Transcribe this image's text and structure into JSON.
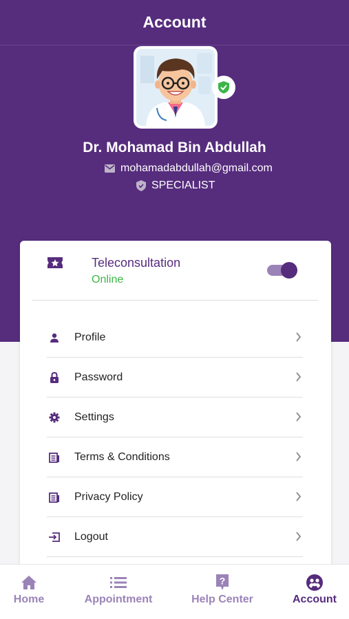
{
  "header": {
    "title": "Account"
  },
  "profile": {
    "name": "Dr. Mohamad Bin Abdullah",
    "email": "mohamadabdullah@gmail.com",
    "role": "SPECIALIST",
    "avatar_icon": "doctor-avatar",
    "verified_icon": "verified-shield-icon"
  },
  "teleconsultation": {
    "title": "Teleconsultation",
    "status": "Online",
    "toggle_on": true,
    "icon": "ticket-star-icon"
  },
  "menu": {
    "items": [
      {
        "label": "Profile",
        "icon": "person-icon"
      },
      {
        "label": "Password",
        "icon": "lock-icon"
      },
      {
        "label": "Settings",
        "icon": "gear-icon"
      },
      {
        "label": "Terms & Conditions",
        "icon": "document-icon"
      },
      {
        "label": "Privacy Policy",
        "icon": "document-icon"
      },
      {
        "label": "Logout",
        "icon": "logout-icon"
      }
    ]
  },
  "tabs": [
    {
      "label": "Home",
      "icon": "home-icon",
      "active": false
    },
    {
      "label": "Appointment",
      "icon": "list-icon",
      "active": false
    },
    {
      "label": "Help Center",
      "icon": "question-icon",
      "active": false
    },
    {
      "label": "Account",
      "icon": "account-icon",
      "active": true
    }
  ],
  "colors": {
    "brand": "#562c7d",
    "brand_light": "#9b83b8",
    "online": "#3db54a",
    "verified": "#3db54a"
  }
}
